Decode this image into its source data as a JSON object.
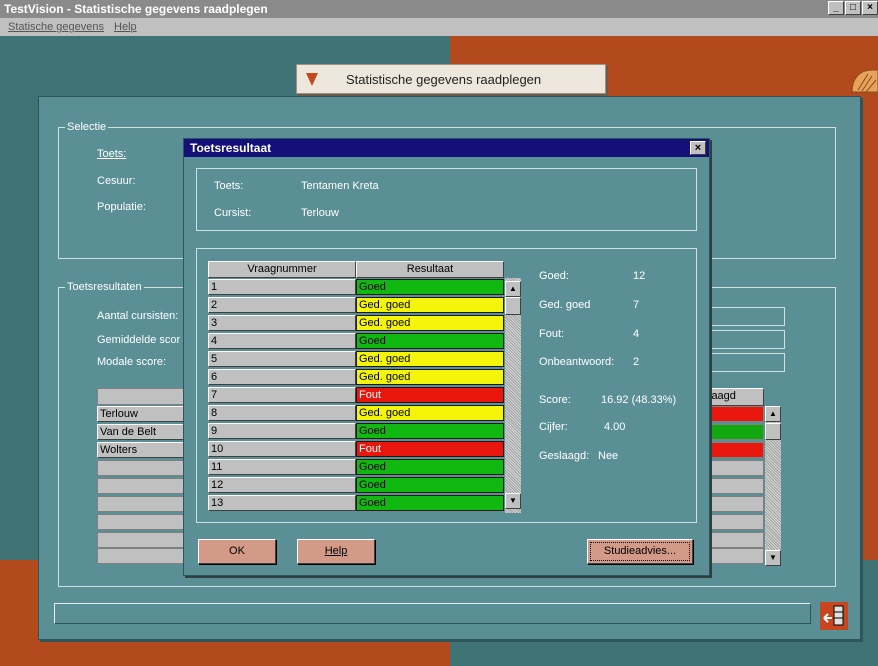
{
  "window": {
    "title": "TestVision - Statistische gegevens raadplegen",
    "min": "_",
    "max": "□",
    "close": "×"
  },
  "menu": {
    "items": [
      "Statische gegevens",
      "Help"
    ]
  },
  "banner": {
    "title": "Statistische gegevens raadplegen"
  },
  "selectie": {
    "caption": "Selectie",
    "toets_label": "Toets:",
    "cesuur_label": "Cesuur:",
    "populatie_label": "Populatie:"
  },
  "toetsresultaten": {
    "caption": "Toetsresultaten",
    "aantal_label": "Aantal cursisten:",
    "gemiddelde_label": "Gemiddelde scor",
    "modale_label": "Modale score:",
    "geslaagd_header": "laagd",
    "students": [
      "Terlouw",
      "Van de Belt",
      "Wolters"
    ],
    "student_status_colors": [
      "#e8160c",
      "#0fa80f",
      "#e8160c"
    ]
  },
  "dialog": {
    "title": "Toetsresultaat",
    "close": "×",
    "toets_label": "Toets:",
    "toets_value": "Tentamen Kreta",
    "cursist_label": "Cursist:",
    "cursist_value": "Terlouw",
    "col_vraag": "Vraagnummer",
    "col_resultaat": "Resultaat",
    "rows": [
      {
        "num": "1",
        "res": "Goed"
      },
      {
        "num": "2",
        "res": "Ged. goed"
      },
      {
        "num": "3",
        "res": "Ged. goed"
      },
      {
        "num": "4",
        "res": "Goed"
      },
      {
        "num": "5",
        "res": "Ged. goed"
      },
      {
        "num": "6",
        "res": "Ged. goed"
      },
      {
        "num": "7",
        "res": "Fout"
      },
      {
        "num": "8",
        "res": "Ged. goed"
      },
      {
        "num": "9",
        "res": "Goed"
      },
      {
        "num": "10",
        "res": "Fout"
      },
      {
        "num": "11",
        "res": "Goed"
      },
      {
        "num": "12",
        "res": "Goed"
      },
      {
        "num": "13",
        "res": "Goed"
      }
    ],
    "colors": {
      "Goed": "#10b810",
      "Ged. goed": "#f5f50a",
      "Fout": "#e8160c"
    },
    "stats": {
      "goed_label": "Goed:",
      "goed_value": "12",
      "gedgoed_label": "Ged. goed",
      "gedgoed_value": "7",
      "fout_label": "Fout:",
      "fout_value": "4",
      "onbeantwoord_label": "Onbeantwoord:",
      "onbeantwoord_value": "2",
      "score_label": "Score:",
      "score_value": "16.92 (48.33%)",
      "cijfer_label": "Cijfer:",
      "cijfer_value": "4.00",
      "geslaagd_label": "Geslaagd:",
      "geslaagd_value": "Nee"
    },
    "buttons": {
      "ok": "OK",
      "help": "Help",
      "studieadvies": "Studieadvies..."
    }
  }
}
